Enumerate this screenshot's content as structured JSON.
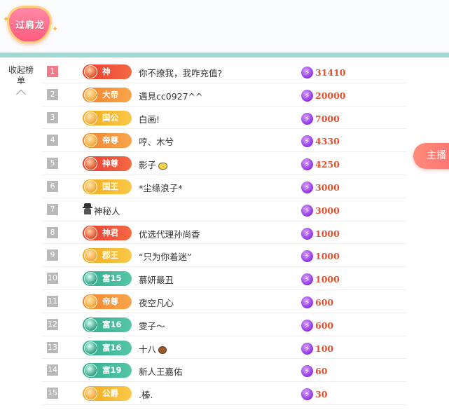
{
  "header": {
    "badge_label": "过肩龙",
    "colors": {
      "badge": "#ff5b7e",
      "divider": "#9fd9d3"
    }
  },
  "sidebar": {
    "collapse_label": "收起榜单"
  },
  "float_tab": {
    "label": "主播"
  },
  "rows": [
    {
      "rank": "1",
      "level": "神",
      "level_style": "red",
      "name": "你不撩我，我咋充值?",
      "score": "31410"
    },
    {
      "rank": "2",
      "level": "大帝",
      "level_style": "orange",
      "name": "遇見cc0927^^",
      "score": "20000"
    },
    {
      "rank": "3",
      "level": "国公",
      "level_style": "gold",
      "name": "白画!",
      "score": "7000"
    },
    {
      "rank": "4",
      "level": "帝尊",
      "level_style": "orange",
      "name": "哼、木兮",
      "score": "4330"
    },
    {
      "rank": "5",
      "level": "神尊",
      "level_style": "red",
      "name": "影子",
      "score": "4250",
      "emoji": "sun-cloud"
    },
    {
      "rank": "6",
      "level": "国王",
      "level_style": "gold",
      "name": "*尘缘浪子*",
      "score": "3000"
    },
    {
      "rank": "7",
      "level": "",
      "level_style": "none",
      "name": "神秘人",
      "score": "3000",
      "mystery": true
    },
    {
      "rank": "8",
      "level": "神君",
      "level_style": "red",
      "name": "优选代理孙尚香",
      "score": "1000"
    },
    {
      "rank": "9",
      "level": "郡王",
      "level_style": "gold",
      "name": "“只为你着迷”",
      "score": "1000"
    },
    {
      "rank": "10",
      "level": "富15",
      "level_style": "teal",
      "name": "慕妍最丑",
      "score": "1000"
    },
    {
      "rank": "11",
      "level": "帝尊",
      "level_style": "orange",
      "name": "夜空凡心",
      "score": "600"
    },
    {
      "rank": "12",
      "level": "富16",
      "level_style": "teal",
      "name": "雯子～",
      "score": "600"
    },
    {
      "rank": "13",
      "level": "富16",
      "level_style": "teal",
      "name": "十八",
      "score": "100",
      "emoji": "bear"
    },
    {
      "rank": "14",
      "level": "富19",
      "level_style": "teal",
      "name": "新人王嘉佑",
      "score": "60"
    },
    {
      "rank": "15",
      "level": "公爵",
      "level_style": "gold",
      "name": ".榛.",
      "score": "30"
    }
  ]
}
